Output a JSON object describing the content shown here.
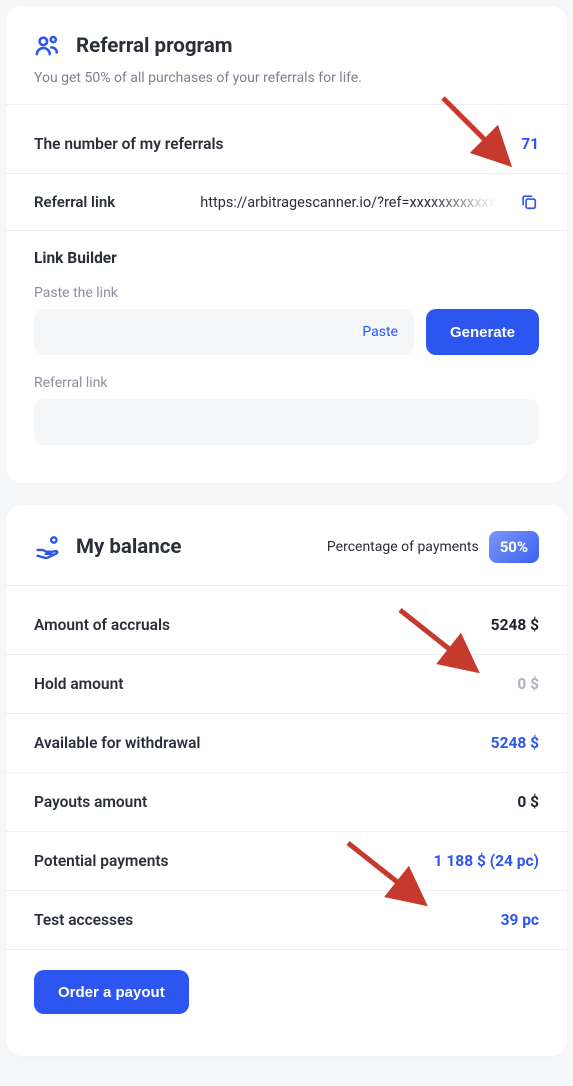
{
  "referral": {
    "title": "Referral program",
    "subtitle": "You get 50% of all purchases of your referrals for life.",
    "count_label": "The number of my referrals",
    "count_value": "71",
    "link_label": "Referral link",
    "link_value": "https://arbitragescanner.io/?ref=xxxxxxxxxxxxx",
    "link_builder_title": "Link Builder",
    "paste_label": "Paste the link",
    "paste_hint": "Paste",
    "generate_label": "Generate",
    "output_label": "Referral link"
  },
  "balance": {
    "title": "My balance",
    "percentage_label": "Percentage of payments",
    "percentage_value": "50%",
    "rows": {
      "accruals_label": "Amount of accruals",
      "accruals_value": "5248 $",
      "hold_label": "Hold amount",
      "hold_value": "0 $",
      "available_label": "Available for withdrawal",
      "available_value": "5248 $",
      "payouts_label": "Payouts amount",
      "payouts_value": "0 $",
      "potential_label": "Potential payments",
      "potential_value": "1 188 $ (24 pc)",
      "test_label": "Test accesses",
      "test_value": "39 pc"
    },
    "order_button": "Order a payout"
  }
}
